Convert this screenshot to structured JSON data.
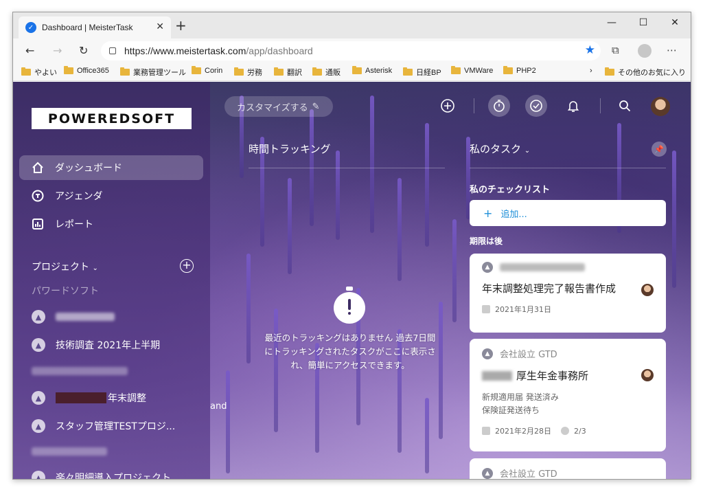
{
  "browser": {
    "tab_title": "Dashboard | MeisterTask",
    "url_host": "https://www.meistertask.com",
    "url_path": "/app/dashboard",
    "bookmarks": [
      "やよい",
      "Office365",
      "業務管理ツール",
      "Corin",
      "労務",
      "翻訳",
      "通販",
      "Asterisk",
      "日経BP",
      "VMWare",
      "PHP2"
    ],
    "other_bookmarks": "その他のお気に入り"
  },
  "sidebar": {
    "logo": "POWEREDSOFT",
    "nav": [
      {
        "label": "ダッシュボード",
        "icon": "home-icon"
      },
      {
        "label": "アジェンダ",
        "icon": "agenda-icon"
      },
      {
        "label": "レポート",
        "icon": "report-icon"
      }
    ],
    "projects_header": "プロジェクト",
    "group_label": "パワードソフト",
    "projects": [
      {
        "label": "技術調査 2021年上半期"
      },
      {
        "label": "年末調整"
      },
      {
        "label": "スタッフ管理TESTプロジ..."
      },
      {
        "label": "楽々明細導入プロジェクト"
      }
    ]
  },
  "topbar": {
    "customize_label": "カスタマイズする"
  },
  "time_tracking": {
    "title": "時間トラッキング",
    "empty_message": "最近のトラッキングはありません 過去7日間にトラッキングされたタスクがここに表示され、簡単にアクセスできます。",
    "stray_text": "and"
  },
  "tasks": {
    "title": "私のタスク",
    "checklist_label": "私のチェックリスト",
    "add_label": "追加...",
    "due_later_label": "期限は後",
    "cards": [
      {
        "project": "",
        "title": "年末調整処理完了報告書作成",
        "date": "2021年1月31日"
      },
      {
        "project": "会社設立 GTD",
        "title": "厚生年金事務所",
        "description": [
          "新規適用届 発送済み",
          "保険証発送待ち"
        ],
        "date": "2021年2月28日",
        "checklist": "2/3"
      },
      {
        "project": "会社設立 GTD"
      }
    ]
  }
}
